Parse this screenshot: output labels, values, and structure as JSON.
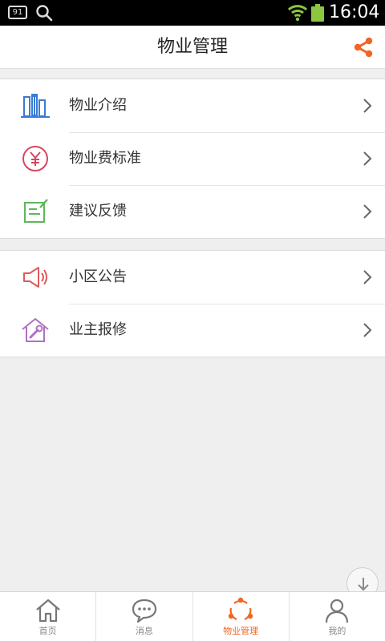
{
  "statusbar": {
    "notification_count": "91",
    "time": "16:04"
  },
  "header": {
    "title": "物业管理",
    "share_icon": "share-icon"
  },
  "colors": {
    "accent": "#f26522",
    "building": "#3a7bd5",
    "fee": "#d9455f",
    "feedback": "#5cb85c",
    "notice": "#e05a5a",
    "repair": "#b06fc4"
  },
  "groups": [
    {
      "items": [
        {
          "label": "物业介绍",
          "icon": "building-icon"
        },
        {
          "label": "物业费标准",
          "icon": "yuan-icon"
        },
        {
          "label": "建议反馈",
          "icon": "edit-note-icon"
        }
      ]
    },
    {
      "items": [
        {
          "label": "小区公告",
          "icon": "megaphone-icon"
        },
        {
          "label": "业主报修",
          "icon": "house-wrench-icon"
        }
      ]
    }
  ],
  "tabbar": {
    "tabs": [
      {
        "label": "首页",
        "icon": "home-icon",
        "active": false
      },
      {
        "label": "消息",
        "icon": "chat-icon",
        "active": false
      },
      {
        "label": "物业管理",
        "icon": "property-icon",
        "active": true
      },
      {
        "label": "我的",
        "icon": "person-icon",
        "active": false
      }
    ]
  }
}
